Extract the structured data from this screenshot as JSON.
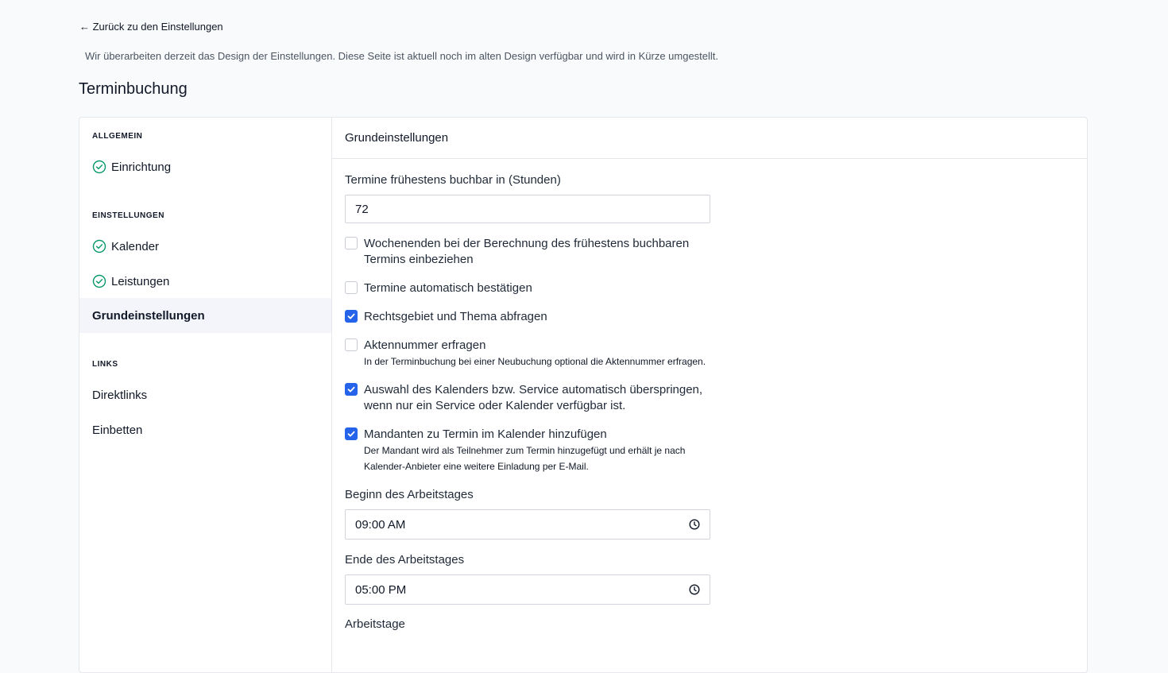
{
  "back_link": "← Zurück zu den Einstellungen",
  "notice": "Wir überarbeiten derzeit das Design der Einstellungen. Diese Seite ist aktuell noch im alten Design verfügbar und wird in Kürze umgestellt.",
  "page_title": "Terminbuchung",
  "sidebar": {
    "sections": [
      {
        "label": "ALLGEMEIN"
      },
      {
        "label": "EINSTELLUNGEN"
      },
      {
        "label": "LINKS"
      }
    ],
    "items": [
      {
        "label": "Einrichtung",
        "done": true
      },
      {
        "label": "Kalender",
        "done": true
      },
      {
        "label": "Leistungen",
        "done": true
      },
      {
        "label": "Grundeinstellungen",
        "active": true
      },
      {
        "label": "Direktlinks"
      },
      {
        "label": "Einbetten"
      }
    ]
  },
  "main": {
    "header": "Grundeinstellungen",
    "earliest_label": "Termine frühestens buchbar in (Stunden)",
    "earliest_value": "72",
    "checkboxes": [
      {
        "label": "Wochenenden bei der Berechnung des frühestens buchbaren Termins einbeziehen",
        "checked": false
      },
      {
        "label": "Termine automatisch bestätigen",
        "checked": false
      },
      {
        "label": "Rechtsgebiet und Thema abfragen",
        "checked": true
      },
      {
        "label": "Aktennummer erfragen",
        "help": "In der Terminbuchung bei einer Neubuchung optional die Aktennummer erfragen.",
        "checked": false
      },
      {
        "label": "Auswahl des Kalenders bzw. Service automatisch überspringen, wenn nur ein Service oder Kalender verfügbar ist.",
        "checked": true
      },
      {
        "label": "Mandanten zu Termin im Kalender hinzufügen",
        "help": "Der Mandant wird als Teilnehmer zum Termin hinzugefügt und erhält je nach Kalender-Anbieter eine weitere Einladung per E-Mail.",
        "checked": true
      }
    ],
    "start_label": "Beginn des Arbeitstages",
    "start_value": "09:00 AM",
    "end_label": "Ende des Arbeitstages",
    "end_value": "05:00 PM",
    "workdays_label": "Arbeitstage"
  },
  "colors": {
    "accent": "#2563eb",
    "success": "#059669"
  },
  "icons": {
    "done": "check-circle-icon",
    "time": "clock-icon",
    "checked": "checkmark-icon"
  }
}
